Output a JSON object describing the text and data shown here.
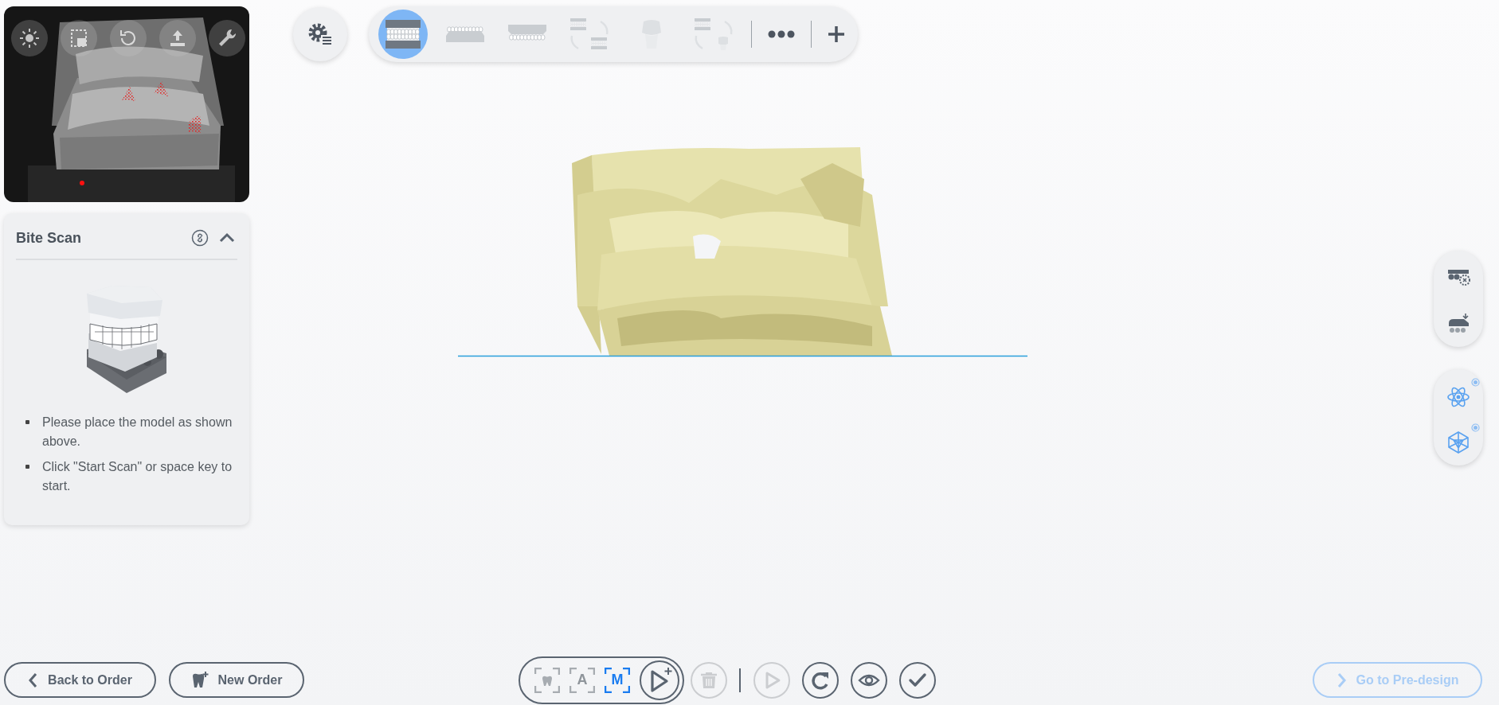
{
  "camera_preview": {
    "kind": "picture",
    "tools": [
      {
        "kind": "brightness"
      },
      {
        "kind": "frame"
      },
      {
        "kind": "rotate"
      },
      {
        "kind": "upload"
      },
      {
        "kind": "wrench"
      }
    ]
  },
  "scan_panel": {
    "title": "Bite Scan",
    "expanded": true,
    "instructions": [
      "Please place the model as shown above.",
      "Click \"Start Scan\" or space key to start."
    ]
  },
  "step_toolbar": {
    "steps": [
      {
        "kind": "bite",
        "selected": true,
        "disabled": false
      },
      {
        "kind": "lower",
        "selected": false,
        "disabled": false
      },
      {
        "kind": "upper",
        "selected": false,
        "disabled": false
      },
      {
        "kind": "swap",
        "selected": false,
        "disabled": true
      },
      {
        "kind": "die",
        "selected": false,
        "disabled": true
      },
      {
        "kind": "die-swap",
        "selected": false,
        "disabled": true
      }
    ]
  },
  "scene": {
    "kind": "picture"
  },
  "right_rail": [
    [
      {
        "kind": "artifact",
        "on": false
      },
      {
        "kind": "fill",
        "on": false
      }
    ],
    [
      {
        "kind": "atom",
        "on": true
      },
      {
        "kind": "mesh",
        "on": true
      }
    ]
  ],
  "bottom_bar": {
    "left_buttons": [
      {
        "kind": "back",
        "label": "Back to Order"
      },
      {
        "kind": "new-order",
        "label": "New Order"
      }
    ],
    "scan_modes": [
      {
        "kind": "tooth",
        "selected": false
      },
      {
        "kind": "letter",
        "label": "A",
        "selected": false
      },
      {
        "kind": "letter",
        "label": "M",
        "selected": true
      }
    ],
    "actions": [
      {
        "kind": "delete",
        "disabled": true
      },
      {
        "kind": "divider"
      },
      {
        "kind": "play",
        "disabled": true
      },
      {
        "kind": "redo",
        "disabled": false
      },
      {
        "kind": "view",
        "disabled": false
      },
      {
        "kind": "confirm",
        "disabled": false
      }
    ],
    "next_button": {
      "label": "Go to Pre-design",
      "disabled": true
    }
  }
}
